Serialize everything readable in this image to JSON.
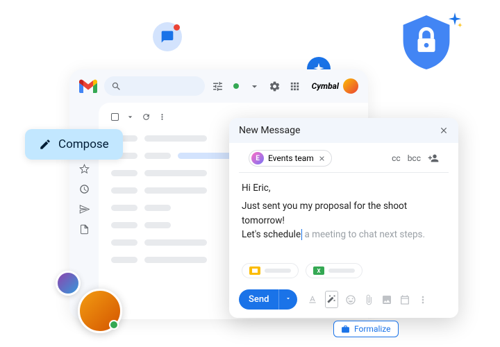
{
  "brand": {
    "name": "Cymbal"
  },
  "compose": {
    "label": "Compose"
  },
  "newMessage": {
    "title": "New Message",
    "recipient": {
      "initial": "E",
      "name": "Events team"
    },
    "cc": "cc",
    "bcc": "bcc",
    "greeting": "Hi Eric,",
    "line1": "Just sent you my proposal for the shoot tomorrow!",
    "line2_typed": "Let's schedule",
    "line2_suggested": " a meeting to chat next steps.",
    "sendLabel": "Send"
  },
  "formalize": {
    "label": "Formalize"
  },
  "icons": {
    "chat": "chat-icon",
    "shield": "shield-lock-icon",
    "sparkle": "sparkle-icon",
    "pencil": "pencil-icon",
    "close": "close-icon",
    "search": "search-icon",
    "tune": "tune-icon",
    "gear": "gear-icon",
    "apps": "apps-icon",
    "chevronDown": "chevron-down-icon",
    "refresh": "refresh-icon",
    "more": "more-vert-icon",
    "inbox": "inbox-icon",
    "star": "star-icon",
    "clock": "clock-icon",
    "sent": "sent-icon",
    "file": "file-icon",
    "personAdd": "person-add-icon",
    "textFormat": "text-format-icon",
    "magic": "magic-wand-icon",
    "emoji": "emoji-icon",
    "attach": "attach-icon",
    "image": "image-icon",
    "calendar": "calendar-icon",
    "briefcase": "briefcase-icon"
  }
}
